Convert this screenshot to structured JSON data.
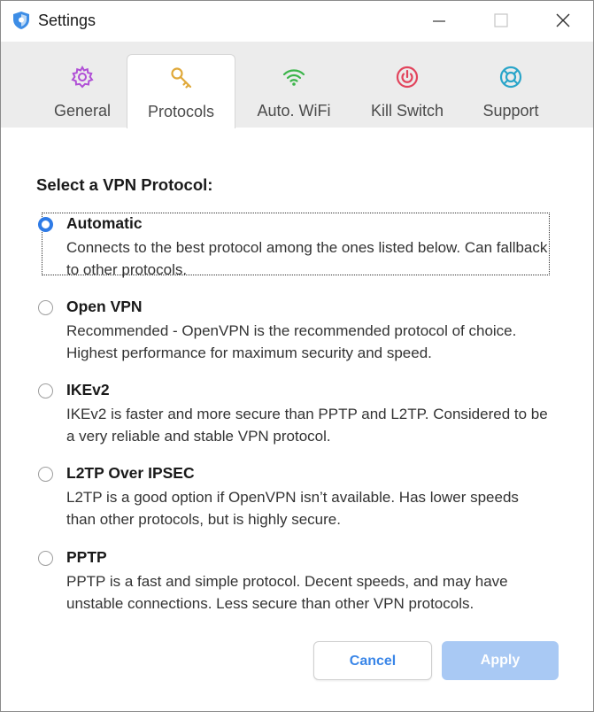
{
  "window": {
    "title": "Settings"
  },
  "titlebar": {
    "icons": {
      "app": "shield-icon",
      "minimize": "minimize-icon",
      "maximize": "maximize-icon",
      "close": "close-icon"
    }
  },
  "tabs": [
    {
      "label": "General",
      "icon": "gear-icon",
      "color": "#b04fd6",
      "active": false
    },
    {
      "label": "Protocols",
      "icon": "key-icon",
      "color": "#e0a93a",
      "active": true
    },
    {
      "label": "Auto. WiFi",
      "icon": "wifi-icon",
      "color": "#3bb54a",
      "active": false
    },
    {
      "label": "Kill Switch",
      "icon": "power-icon",
      "color": "#e2445c",
      "active": false
    },
    {
      "label": "Support",
      "icon": "lifebuoy-icon",
      "color": "#2aa5c9",
      "active": false
    }
  ],
  "content": {
    "section_title": "Select a VPN Protocol:",
    "options": [
      {
        "name": "Automatic",
        "description": "Connects to the best protocol among the ones listed below. Can fallback to other protocols.",
        "selected": true
      },
      {
        "name": "Open VPN",
        "description": "Recommended - OpenVPN is the recommended protocol of choice. Highest performance for maximum security and speed.",
        "selected": false
      },
      {
        "name": "IKEv2",
        "description": "IKEv2 is faster and more secure than PPTP and L2TP. Considered to be a very reliable and stable VPN protocol.",
        "selected": false
      },
      {
        "name": "L2TP Over IPSEC",
        "description": "L2TP is a good option if OpenVPN isn’t available. Has lower speeds than other protocols, but is highly secure.",
        "selected": false
      },
      {
        "name": "PPTP",
        "description": "PPTP is a fast and simple protocol. Decent speeds, and may have unstable connections. Less secure than other VPN protocols.",
        "selected": false
      }
    ]
  },
  "buttons": {
    "cancel_label": "Cancel",
    "apply_label": "Apply"
  },
  "colors": {
    "accent": "#2f7be6",
    "apply_disabled_bg": "#a9c9f4",
    "tab_bar_bg": "#ececec"
  }
}
